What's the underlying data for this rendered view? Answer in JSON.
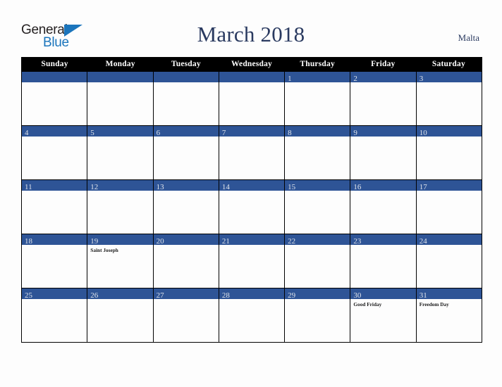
{
  "header": {
    "logo": {
      "line_one": "General",
      "line_two": "Blue",
      "triangle_color": "#1b75bc"
    },
    "title": "March 2018",
    "country": "Malta",
    "title_color": "#2a3a60"
  },
  "calendar": {
    "weekdays": [
      "Sunday",
      "Monday",
      "Tuesday",
      "Wednesday",
      "Thursday",
      "Friday",
      "Saturday"
    ],
    "weekday_header_bg": "#000000",
    "day_bar_bg": "#2e5496",
    "weeks": [
      [
        {
          "day": "",
          "events": []
        },
        {
          "day": "",
          "events": []
        },
        {
          "day": "",
          "events": []
        },
        {
          "day": "",
          "events": []
        },
        {
          "day": "1",
          "events": []
        },
        {
          "day": "2",
          "events": []
        },
        {
          "day": "3",
          "events": []
        }
      ],
      [
        {
          "day": "4",
          "events": []
        },
        {
          "day": "5",
          "events": []
        },
        {
          "day": "6",
          "events": []
        },
        {
          "day": "7",
          "events": []
        },
        {
          "day": "8",
          "events": []
        },
        {
          "day": "9",
          "events": []
        },
        {
          "day": "10",
          "events": []
        }
      ],
      [
        {
          "day": "11",
          "events": []
        },
        {
          "day": "12",
          "events": []
        },
        {
          "day": "13",
          "events": []
        },
        {
          "day": "14",
          "events": []
        },
        {
          "day": "15",
          "events": []
        },
        {
          "day": "16",
          "events": []
        },
        {
          "day": "17",
          "events": []
        }
      ],
      [
        {
          "day": "18",
          "events": []
        },
        {
          "day": "19",
          "events": [
            "Saint Joseph"
          ]
        },
        {
          "day": "20",
          "events": []
        },
        {
          "day": "21",
          "events": []
        },
        {
          "day": "22",
          "events": []
        },
        {
          "day": "23",
          "events": []
        },
        {
          "day": "24",
          "events": []
        }
      ],
      [
        {
          "day": "25",
          "events": []
        },
        {
          "day": "26",
          "events": []
        },
        {
          "day": "27",
          "events": []
        },
        {
          "day": "28",
          "events": []
        },
        {
          "day": "29",
          "events": []
        },
        {
          "day": "30",
          "events": [
            "Good Friday"
          ]
        },
        {
          "day": "31",
          "events": [
            "Freedom Day"
          ]
        }
      ]
    ]
  }
}
